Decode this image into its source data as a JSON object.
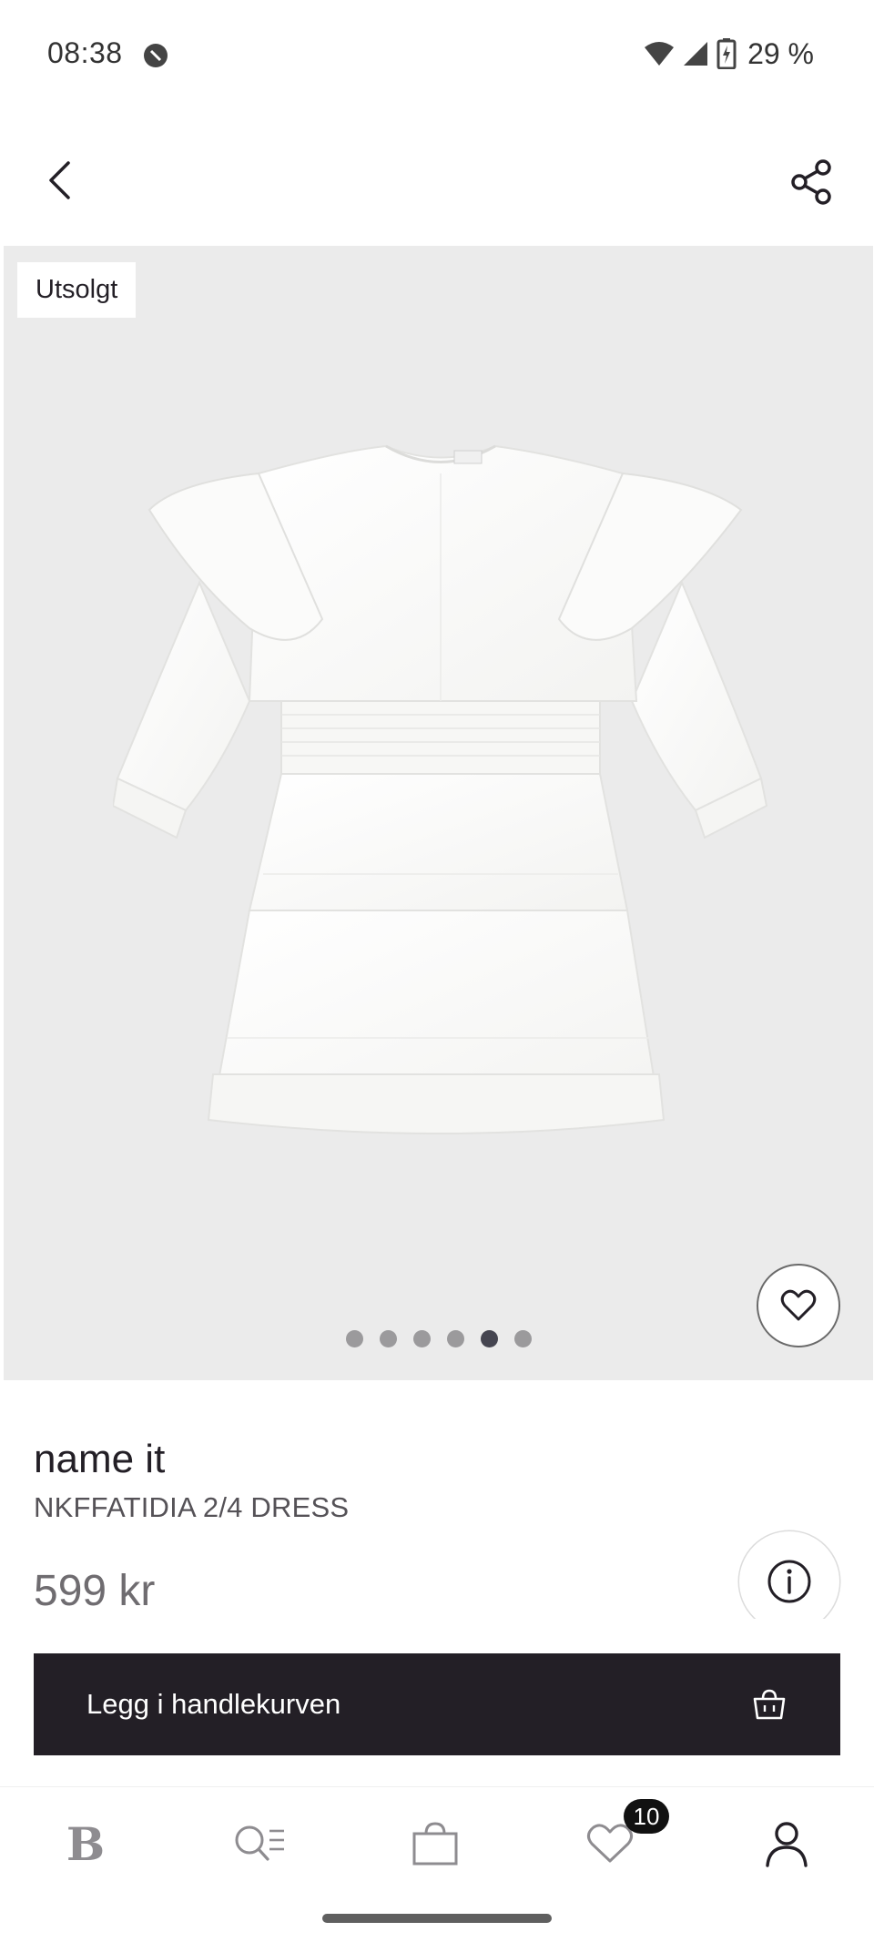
{
  "status_bar": {
    "time": "08:38",
    "battery": "29 %",
    "icons": [
      "do-not-disturb-icon",
      "wifi-icon",
      "signal-icon",
      "battery-charging-icon"
    ]
  },
  "nav": {
    "back_icon": "chevron-left-icon",
    "share_icon": "share-icon"
  },
  "gallery": {
    "sold_out_badge": "Utsolgt",
    "image_count": 6,
    "active_image": 5,
    "favorite_icon": "heart-outline-icon"
  },
  "product": {
    "brand": "name it",
    "name": "NKFFATIDIA 2/4 DRESS",
    "price": "599 kr",
    "info_icon": "info-icon"
  },
  "cart": {
    "label": "Legg i handlekurven",
    "icon": "shopping-bag-icon"
  },
  "bottom_nav": {
    "items": [
      {
        "name": "home",
        "icon": "logo-b",
        "label_glyph": "B"
      },
      {
        "name": "search",
        "icon": "search-menu-icon"
      },
      {
        "name": "cart",
        "icon": "shopping-bag-icon"
      },
      {
        "name": "favorites",
        "icon": "heart-outline-icon"
      },
      {
        "name": "account",
        "icon": "user-icon"
      }
    ],
    "favorites_badge": "10"
  },
  "colors": {
    "primary_dark": "#231f26",
    "gallery_bg": "#ebebeb",
    "muted_text": "#6f6c70"
  }
}
